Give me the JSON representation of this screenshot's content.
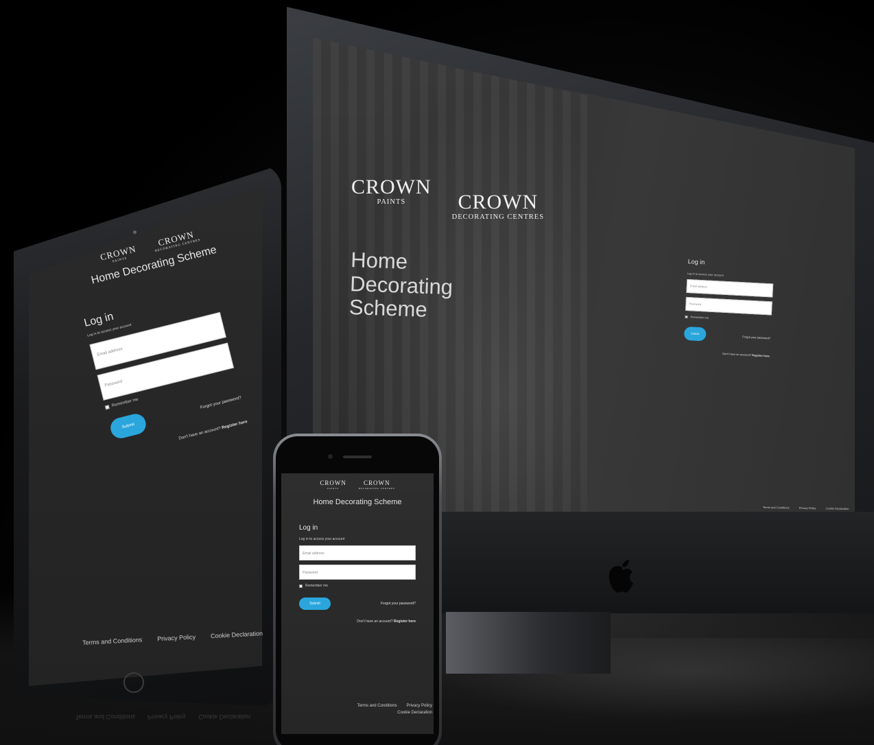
{
  "brand": {
    "logo_primary": "CROWN",
    "logo_primary_sub": "PAINTS",
    "logo_secondary": "CROWN",
    "logo_secondary_sub": "DECORATING CENTRES",
    "accent_color": "#2aa6dd"
  },
  "desktop": {
    "heading": "Home Decorating Scheme",
    "login": {
      "title": "Log in",
      "subtitle": "Log in to access your account",
      "email_placeholder": "Email address",
      "password_placeholder": "Password",
      "remember_label": "Remember me",
      "submit_label": "Submit",
      "forgot_label": "Forgot your password?",
      "register_prompt": "Don't have an account?",
      "register_link": "Register here"
    },
    "footer": [
      "Terms and Conditions",
      "Privacy Policy",
      "Cookie Declaration"
    ]
  },
  "tablet": {
    "heading": "Home Decorating Scheme",
    "login": {
      "title": "Log in",
      "subtitle": "Log in to access your account",
      "email_placeholder": "Email address",
      "password_placeholder": "Password",
      "remember_label": "Remember me",
      "submit_label": "Submit",
      "forgot_label": "Forgot your password?",
      "register_prompt": "Don't have an account?",
      "register_link": "Register here"
    },
    "footer": [
      "Terms and Conditions",
      "Privacy Policy",
      "Cookie Declaration"
    ]
  },
  "phone": {
    "heading": "Home Decorating Scheme",
    "login": {
      "title": "Log in",
      "subtitle": "Log in to access your account",
      "email_placeholder": "Email address",
      "password_placeholder": "Password",
      "remember_label": "Remember me",
      "submit_label": "Submit",
      "forgot_label": "Forgot your password?",
      "register_prompt": "Don't have an account?",
      "register_link": "Register here"
    },
    "footer": [
      "Terms and Conditions",
      "Privacy Policy",
      "Cookie Declaration"
    ]
  },
  "icons": [
    "apple-logo-icon",
    "crown-icon",
    "checkbox-icon"
  ]
}
